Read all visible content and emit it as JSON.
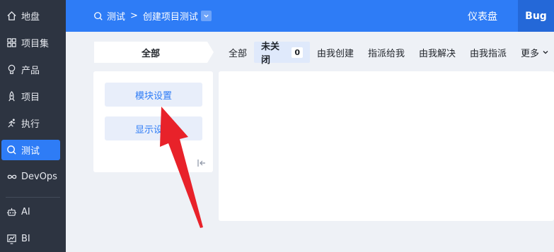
{
  "sidebar": {
    "items": [
      {
        "label": "地盘",
        "icon": "home-icon"
      },
      {
        "label": "项目集",
        "icon": "grid-icon"
      },
      {
        "label": "产品",
        "icon": "bulb-icon"
      },
      {
        "label": "项目",
        "icon": "rocket-icon"
      },
      {
        "label": "执行",
        "icon": "run-icon"
      },
      {
        "label": "测试",
        "icon": "test-icon"
      },
      {
        "label": "DevOps",
        "icon": "infinity-icon"
      },
      {
        "label": "AI",
        "icon": "robot-icon"
      },
      {
        "label": "BI",
        "icon": "chart-icon"
      }
    ],
    "active": "测试"
  },
  "topbar": {
    "section": "测试",
    "separator": ">",
    "page": "创建项目测试",
    "dashboard": "仪表盘",
    "bug_tab": "Bug"
  },
  "filters": {
    "all_chip": "全部",
    "tabs": [
      {
        "label": "全部"
      },
      {
        "label": "未关闭",
        "count": "0"
      },
      {
        "label": "由我创建"
      },
      {
        "label": "指派给我"
      },
      {
        "label": "由我解决"
      },
      {
        "label": "由我指派"
      },
      {
        "label": "更多"
      }
    ]
  },
  "module_panel": {
    "module_settings": "模块设置",
    "display_settings": "显示设置"
  },
  "colors": {
    "sidebar_bg": "#2d3441",
    "accent": "#2e7cf6",
    "annotation_arrow": "#e8222a"
  }
}
